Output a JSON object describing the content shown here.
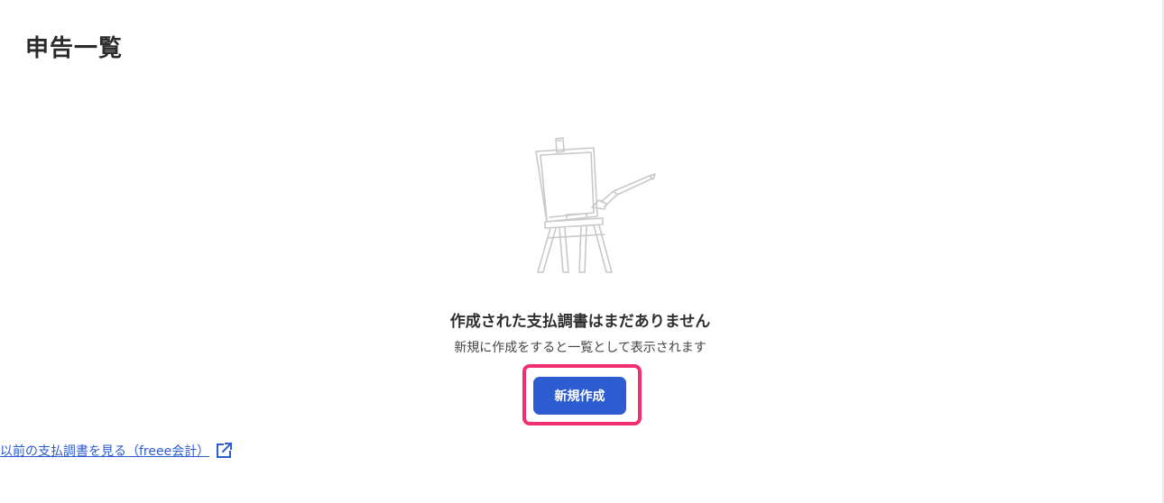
{
  "header": {
    "title": "申告一覧"
  },
  "empty_state": {
    "title": "作成された支払調書はまだありません",
    "description": "新規に作成をすると一覧として表示されます",
    "illustration_icon": "easel-with-paintbrush-icon"
  },
  "actions": {
    "create_label": "新規作成"
  },
  "links": {
    "old_records_label": "以前の支払調書を見る（freee会計）",
    "old_records_icon": "external-link-icon"
  },
  "colors": {
    "primary": "#2d5bd0",
    "highlight": "#f0306f",
    "text": "#323232"
  }
}
